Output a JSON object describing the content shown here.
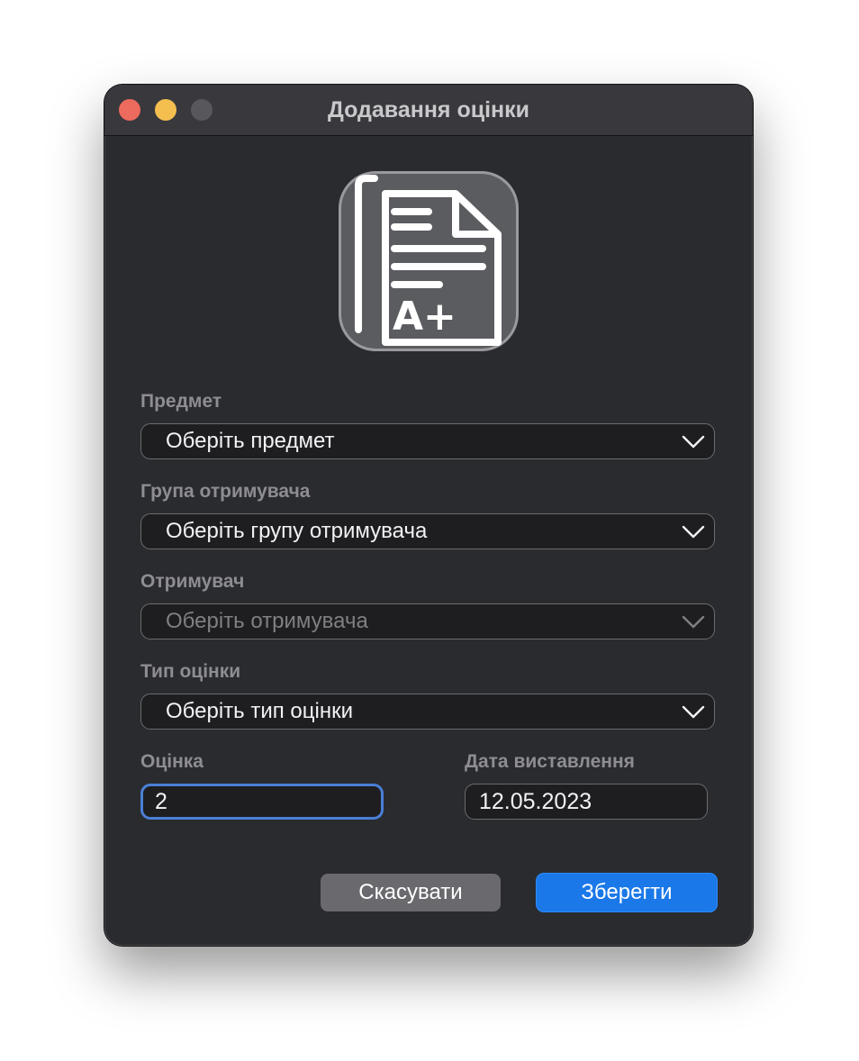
{
  "window": {
    "title": "Додавання оцінки"
  },
  "icon": {
    "name": "grade-document-icon",
    "glyph": "A+"
  },
  "form": {
    "subject": {
      "label": "Предмет",
      "value": "Оберіть предмет"
    },
    "recipient_group": {
      "label": "Група отримувача",
      "value": "Оберіть групу отримувача"
    },
    "recipient": {
      "label": "Отримувач",
      "value": "Оберіть отримувача",
      "disabled": true
    },
    "grade_type": {
      "label": "Тип оцінки",
      "value": "Оберіть тип оцінки"
    },
    "grade": {
      "label": "Оцінка",
      "value": "2"
    },
    "date": {
      "label": "Дата виставлення",
      "value": "12.05.2023"
    }
  },
  "buttons": {
    "cancel": "Скасувати",
    "save": "Зберегти"
  },
  "colors": {
    "window_bg": "#2a2b2f",
    "titlebar_bg": "#39383d",
    "accent": "#1b78e8",
    "focus_ring": "#4a7fd6",
    "close": "#ed6a5e",
    "minimize": "#f5bf4f",
    "zoom_disabled": "#58575c"
  }
}
